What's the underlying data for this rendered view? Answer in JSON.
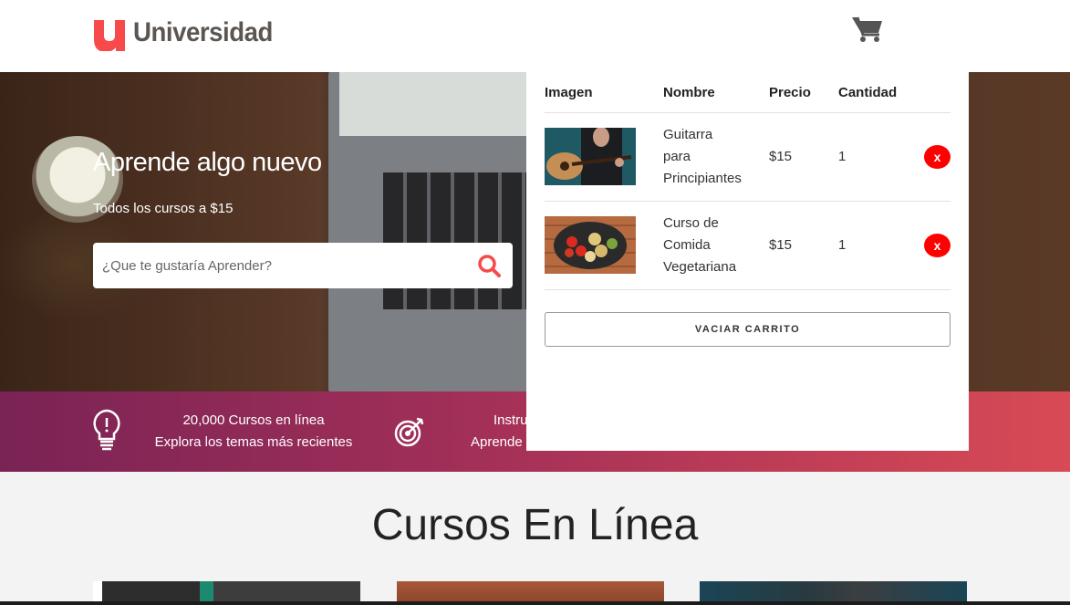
{
  "brand": {
    "letter": "u",
    "name": "Universidad",
    "color": "#f74a4a"
  },
  "header": {
    "cart_icon": "shopping-cart-icon"
  },
  "hero": {
    "title": "Aprende algo nuevo",
    "subtitle": "Todos los cursos a $15",
    "search_placeholder": "¿Que te gustaría Aprender?",
    "search_icon": "search-icon"
  },
  "features": [
    {
      "icon": "lightbulb-icon",
      "line1": "20,000 Cursos en línea",
      "line2": "Explora los temas más recientes"
    },
    {
      "icon": "target-icon",
      "line1": "Instru",
      "line2": "Aprende"
    }
  ],
  "section": {
    "title": "Cursos En Línea"
  },
  "cart": {
    "headers": [
      "Imagen",
      "Nombre",
      "Precio",
      "Cantidad"
    ],
    "items": [
      {
        "image": "guitar-thumbnail",
        "name_lines": [
          "Guitarra",
          "para",
          "Principiantes"
        ],
        "price": "$15",
        "qty": "1",
        "remove_label": "x"
      },
      {
        "image": "vegetarian-food-thumbnail",
        "name_lines": [
          "Curso de",
          "Comida",
          "Vegetariana"
        ],
        "price": "$15",
        "qty": "1",
        "remove_label": "x"
      }
    ],
    "empty_label": "VACIAR CARRITO"
  },
  "colors": {
    "accent": "#f74a4a",
    "remove": "#ff0000",
    "bar_start": "#7a2355",
    "bar_end": "#d84a55"
  }
}
